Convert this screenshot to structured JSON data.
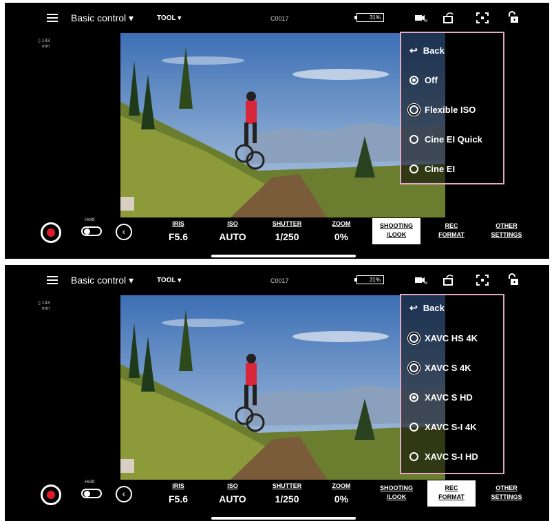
{
  "screens": [
    {
      "mode": "Basic control",
      "tool": "TOOL",
      "clip": "C0017",
      "battery": "31%",
      "info_lines": [
        "143",
        "min"
      ],
      "menu": {
        "back": "Back",
        "items": [
          {
            "label": "Off",
            "state": "selected"
          },
          {
            "label": "Flexible ISO",
            "state": "double"
          },
          {
            "label": "Cine EI Quick",
            "state": "off"
          },
          {
            "label": "Cine EI",
            "state": "off"
          }
        ]
      },
      "hold": "Hold",
      "params": [
        {
          "label": "IRIS",
          "value": "F5.6"
        },
        {
          "label": "ISO",
          "value": "AUTO"
        },
        {
          "label": "SHUTTER",
          "value": "1/250"
        },
        {
          "label": "ZOOM",
          "value": "0%"
        }
      ],
      "tabs": [
        {
          "line1": "SHOOTING",
          "line2": "/LOOK"
        },
        {
          "line1": "REC",
          "line2": "FORMAT"
        },
        {
          "line1": "OTHER",
          "line2": "SETTINGS"
        }
      ],
      "active_tab": 0
    },
    {
      "mode": "Basic control",
      "tool": "TOOL",
      "clip": "C0017",
      "battery": "31%",
      "info_lines": [
        "143",
        "min"
      ],
      "menu": {
        "back": "Back",
        "items": [
          {
            "label": "XAVC HS 4K",
            "state": "double"
          },
          {
            "label": "XAVC S 4K",
            "state": "double"
          },
          {
            "label": "XAVC S HD",
            "state": "selected"
          },
          {
            "label": "XAVC S-I 4K",
            "state": "off"
          },
          {
            "label": "XAVC S-I HD",
            "state": "off"
          }
        ]
      },
      "hold": "Hold",
      "params": [
        {
          "label": "IRIS",
          "value": "F5.6"
        },
        {
          "label": "ISO",
          "value": "AUTO"
        },
        {
          "label": "SHUTTER",
          "value": "1/250"
        },
        {
          "label": "ZOOM",
          "value": "0%"
        }
      ],
      "tabs": [
        {
          "line1": "SHOOTING",
          "line2": "/LOOK"
        },
        {
          "line1": "REC",
          "line2": "FORMAT"
        },
        {
          "line1": "OTHER",
          "line2": "SETTINGS"
        }
      ],
      "active_tab": 1
    }
  ]
}
